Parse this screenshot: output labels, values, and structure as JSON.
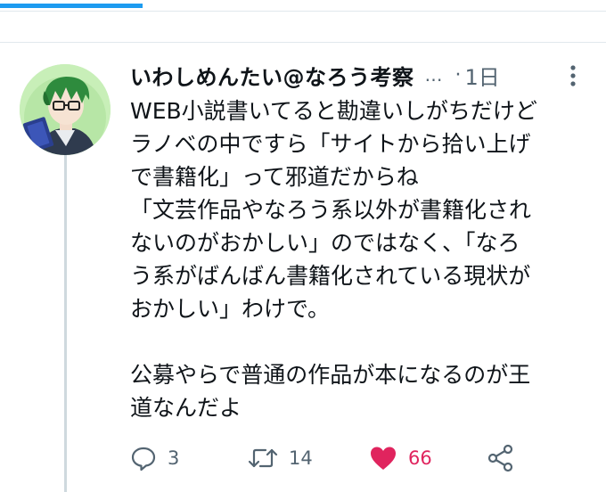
{
  "tabs": {
    "active_indicator_color": "#1d9bf0"
  },
  "tweet": {
    "display_name": "いわしめんたい@なろう考察",
    "truncation": "…",
    "separator": "·",
    "timestamp": "1日",
    "text_lines": [
      "WEB小説書いてると勘違いしがちだけど",
      "ラノベの中ですら「サイトから拾い上げ",
      "で書籍化」って邪道だからね",
      "「文芸作品やなろう系以外が書籍化され",
      "ないのがおかしい」のではなく、「なろ",
      "う系がばんばん書籍化されている現状が",
      "おかしい」わけで。",
      "",
      "公募やらで普通の作品が本になるのが王",
      "道なんだよ"
    ],
    "reply_count": "3",
    "retweet_count": "14",
    "like_count": "66",
    "like_color": "#e0245e",
    "icons": {
      "reply": "reply-icon",
      "retweet": "retweet-icon",
      "like": "heart-icon",
      "share": "share-icon",
      "more": "more-icon"
    }
  }
}
